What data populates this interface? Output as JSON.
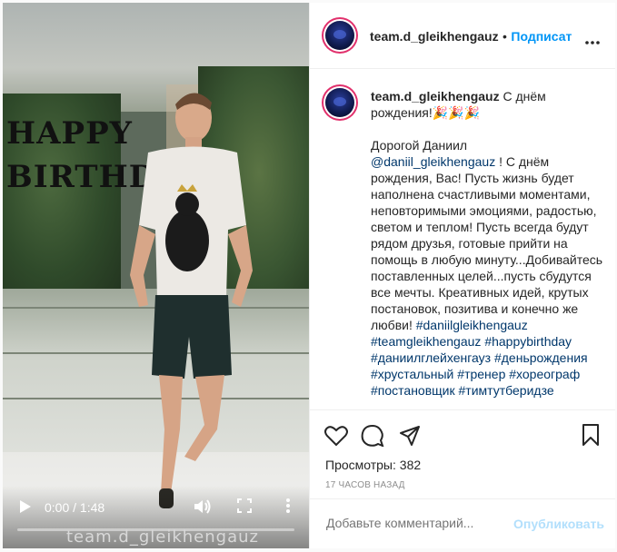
{
  "video": {
    "overlay_line1": "HAPPY",
    "overlay_line2": "BIRTHDAY",
    "watermark": "team.d_gleikhengauz",
    "time": "0:00 / 1:48",
    "progress": 0
  },
  "header": {
    "username": "team.d_gleikhengauz",
    "separator": "•",
    "follow_label": "Подписаться",
    "more_icon": "more-dots-icon"
  },
  "caption": {
    "username": "team.d_gleikhengauz",
    "text": "С днём рождения!🎉🎉🎉"
  },
  "comment": {
    "greeting": "Дорогой Даниил",
    "mention": "@daniil_gleikhengauz",
    "body1": " ! С днём рождения, Вас! Пусть жизнь будет наполнена счастливыми моментами, неповторимыми эмоциями, радостью, светом и теплом! Пусть всегда будут рядом друзья, готовые прийти на помощь в любую минуту...Добивайтесь поставленных целей...пусть сбудутся все мечты. Креативных идей, крутых постановок, позитива и конечно же любви! ",
    "hashtags": [
      "#daniilgleikhengauz",
      "#teamgleikhengauz",
      "#happybirthday",
      "#даниилглейхенгауз",
      "#деньрождения",
      "#хрустальный",
      "#тренер",
      "#хореограф",
      "#постановщик",
      "#тимтутберидзе"
    ]
  },
  "actions": {
    "views_label": "Просмотры:",
    "views_count": "382",
    "timestamp": "17 ЧАСОВ НАЗАД"
  },
  "add_comment": {
    "placeholder": "Добавьте комментарий...",
    "publish_label": "Опубликовать"
  },
  "colors": {
    "accent": "#0095f6",
    "link": "#00376b",
    "text": "#262626",
    "muted": "#8e8e8e",
    "publish_disabled": "#b2dffc"
  }
}
